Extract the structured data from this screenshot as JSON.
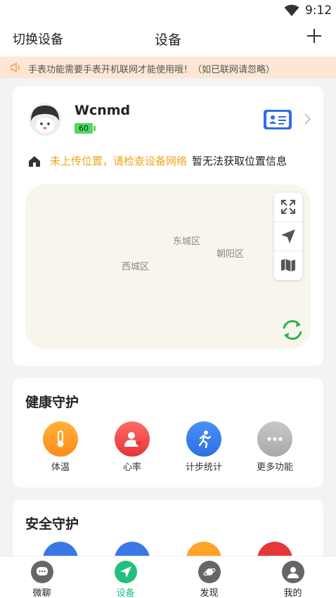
{
  "status_bar": {
    "time": "9:12"
  },
  "header": {
    "switch_label": "切换设备",
    "title": "设备"
  },
  "notice": {
    "text": "手表功能需要手表开机联网才能使用哦！（如已联网请忽略）"
  },
  "device": {
    "name": "Wcnmd",
    "battery": "60",
    "location_warning": "未上传位置，请检查设备网络",
    "location_info": "暂无法获取位置信息"
  },
  "map": {
    "places": [
      "东城区",
      "朝阳区",
      "西城区"
    ]
  },
  "health": {
    "title": "健康守护",
    "items": [
      {
        "label": "体温",
        "icon": "thermometer-icon"
      },
      {
        "label": "心率",
        "icon": "heart-rate-icon"
      },
      {
        "label": "计步统计",
        "icon": "running-icon"
      },
      {
        "label": "更多功能",
        "icon": "more-icon"
      }
    ]
  },
  "safety": {
    "title": "安全守护"
  },
  "tabs": [
    {
      "label": "微聊",
      "icon": "chat-icon",
      "active": false
    },
    {
      "label": "设备",
      "icon": "device-send-icon",
      "active": true
    },
    {
      "label": "发现",
      "icon": "planet-icon",
      "active": false
    },
    {
      "label": "我的",
      "icon": "user-icon",
      "active": false
    }
  ],
  "colors": {
    "accent_green": "#22c07e",
    "warning_orange": "#f3a21b",
    "notice_bg": "#fde6d3"
  }
}
